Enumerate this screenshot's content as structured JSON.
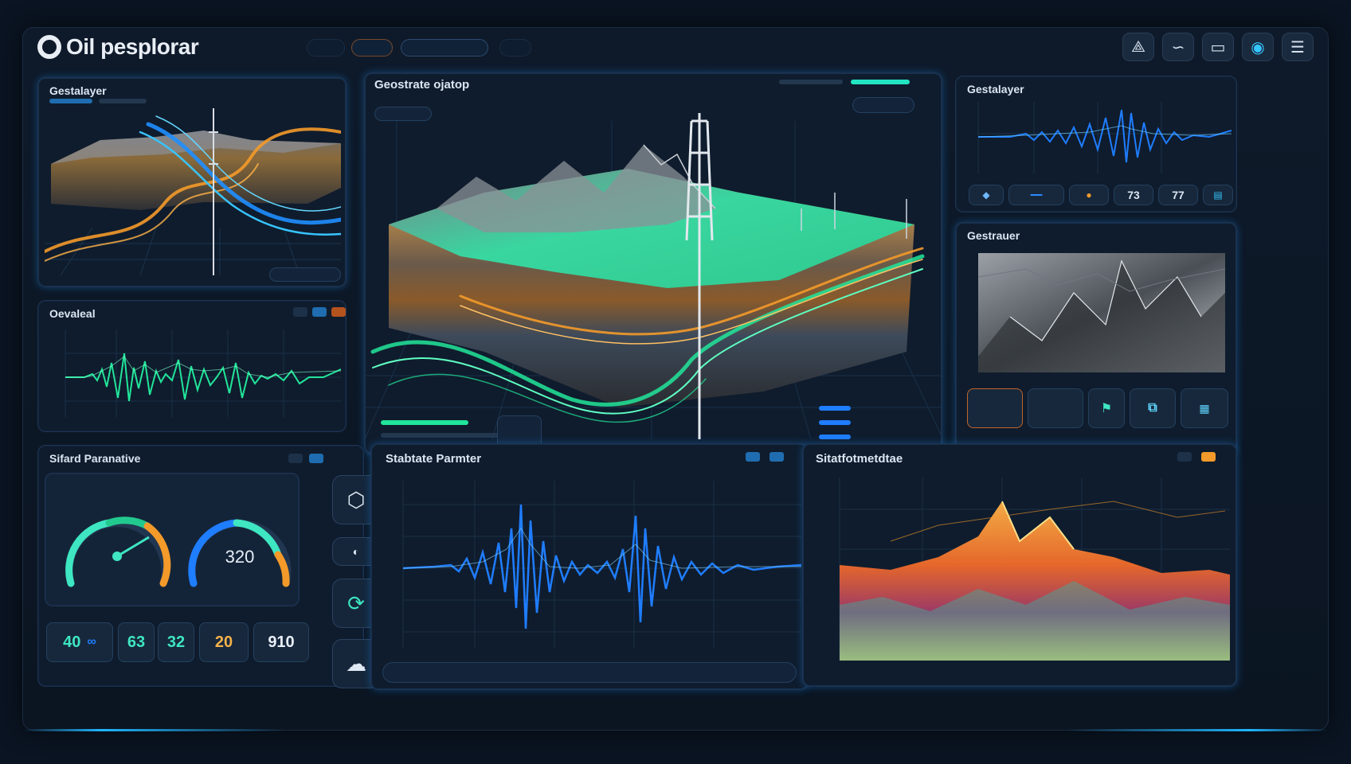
{
  "app": {
    "name": "Oil pesplorar"
  },
  "panels": {
    "top_left": {
      "title": "Gestalayer"
    },
    "center": {
      "title": "Geostrate ojatop"
    },
    "wave_left": {
      "title": "Oevaleal"
    },
    "top_right": {
      "title": "Gestalayer"
    },
    "mid_right": {
      "title": "Gestrauer"
    },
    "params_left": {
      "title": "Sifard Paranative"
    },
    "params_center": {
      "title": "Stabtate Parmter"
    },
    "heat": {
      "title": "Sitatfotmetdtae"
    }
  },
  "gauges": [
    {
      "value": "",
      "level": 0.42
    },
    {
      "value": "320",
      "level": 0.78
    }
  ],
  "stats": [
    {
      "value": "40",
      "color": "#3ee6c2"
    },
    {
      "value": "63",
      "color": "#3ee6c2"
    },
    {
      "value": "32",
      "color": "#3ee6c2"
    },
    {
      "value": "20",
      "color": "#f3b14a"
    },
    {
      "value": "910",
      "color": "#e8eef6"
    }
  ],
  "right_chips": [
    "73",
    "77"
  ],
  "icons": {
    "top": [
      "navigate-icon",
      "link-icon",
      "display-icon",
      "power-icon",
      "stack-icon"
    ],
    "side": [
      "cube-icon",
      "toggle-icon",
      "refresh-icon",
      "cloud-icon"
    ]
  },
  "colors": {
    "accent": "#1fb6ff",
    "green": "#22e59a",
    "orange": "#f39a2a",
    "blue": "#1f7dff"
  }
}
